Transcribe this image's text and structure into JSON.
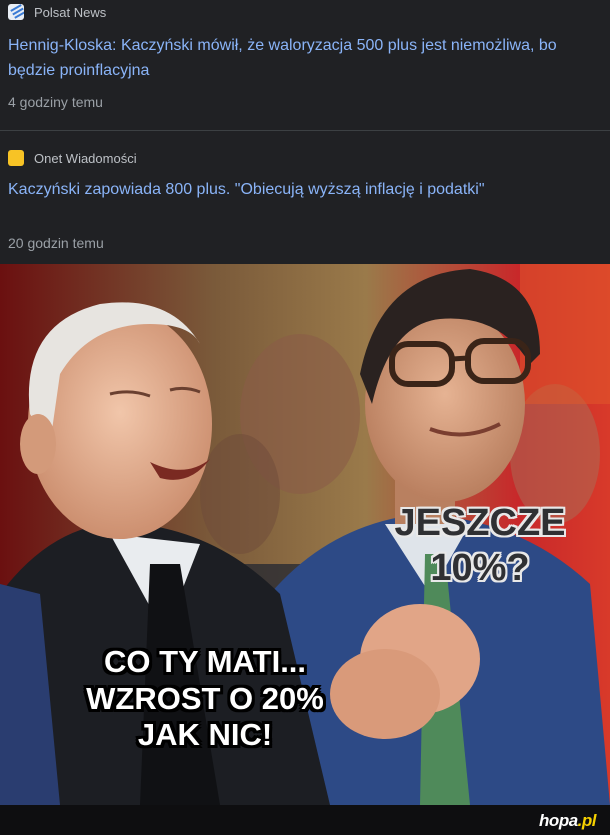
{
  "news": [
    {
      "source": "Polsat News",
      "source_icon": "polsat-news-icon",
      "headline": "Hennig-Kloska: Kaczyński mówił, że waloryzacja 500 plus jest niemożliwa, bo będzie proinflacyjna",
      "time": "4 godziny temu"
    },
    {
      "source": "Onet Wiadomości",
      "source_icon": "onet-icon",
      "headline": "Kaczyński zapowiada 800 plus. \"Obiecują wyższą inflację i podatki\"",
      "time": "20 godzin temu"
    }
  ],
  "meme": {
    "caption_left": "CO TY MATI...\nWZROST O 20%\nJAK NIC!",
    "caption_right": "JESZCZE\n10%?"
  },
  "watermark": {
    "text_main": "hopa",
    "text_accent": ".pl"
  },
  "colors": {
    "background": "#202124",
    "headline": "#8ab4f8",
    "source": "#bdc1c6",
    "time": "#9aa0a6",
    "onet_icon": "#f7c325"
  }
}
